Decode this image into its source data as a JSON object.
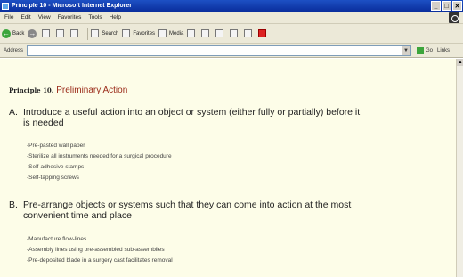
{
  "window": {
    "title": "Principle 10 - Microsoft Internet Explorer",
    "controls": [
      "_",
      "□",
      "✕"
    ]
  },
  "menubar": {
    "items": [
      "File",
      "Edit",
      "View",
      "Favorites",
      "Tools",
      "Help"
    ]
  },
  "toolbar": {
    "back_label": "Back",
    "search_label": "Search",
    "favorites_label": "Favorites",
    "media_label": "Media"
  },
  "addressbar": {
    "label": "Address",
    "value": "",
    "go_label": "Go",
    "links_label": "Links"
  },
  "page": {
    "principle_number": "Principle 10.",
    "principle_name": "Preliminary Action",
    "section_a": {
      "letter": "A.",
      "text": "Introduce a useful action into an object or system (either fully or partially) before it is needed",
      "examples": [
        "-Pre-pasted wall paper",
        "-Sterilize all instruments needed for a surgical procedure",
        "-Self-adhesive stamps",
        "-Self-tapping screws"
      ]
    },
    "section_b": {
      "letter": "B.",
      "text": "Pre-arrange objects or systems such that they can come into action at the most convenient time and place",
      "examples": [
        "-Manufacture flow-lines",
        "-Assembly lines using pre-assembled sub-assemblies",
        "-Pre-deposited blade in a surgery cast facilitates removal"
      ]
    }
  }
}
